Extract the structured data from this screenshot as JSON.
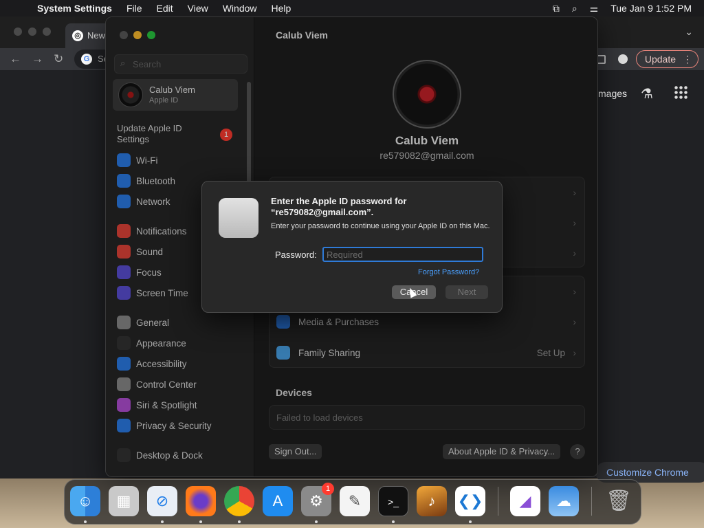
{
  "menubar": {
    "app_name": "System Settings",
    "menus": [
      "File",
      "Edit",
      "View",
      "Window",
      "Help"
    ],
    "datetime": "Tue Jan 9  1:52 PM"
  },
  "chrome": {
    "tab_title": "New",
    "omnibox_text": "Se",
    "update_label": "Update",
    "images_link": "mages",
    "customize_label": "Customize Chrome"
  },
  "settings": {
    "search_placeholder": "Search",
    "account": {
      "name": "Calub Viem",
      "sub": "Apple ID"
    },
    "update_apple_id": "Update Apple ID Settings",
    "update_badge": "1",
    "sidebar": [
      {
        "label": "Wi-Fi",
        "icon": "wifi-icon",
        "color": "#2b7de9"
      },
      {
        "label": "Bluetooth",
        "icon": "bluetooth-icon",
        "color": "#2b7de9"
      },
      {
        "label": "Network",
        "icon": "globe-icon",
        "color": "#2b7de9"
      },
      {
        "label": "Notifications",
        "icon": "bell-icon",
        "color": "#e5443a"
      },
      {
        "label": "Sound",
        "icon": "speaker-icon",
        "color": "#e5443a"
      },
      {
        "label": "Focus",
        "icon": "moon-icon",
        "color": "#5b4fd6"
      },
      {
        "label": "Screen Time",
        "icon": "hourglass-icon",
        "color": "#5b4fd6"
      },
      {
        "label": "General",
        "icon": "gear-icon",
        "color": "#8a8a8a"
      },
      {
        "label": "Appearance",
        "icon": "appearance-icon",
        "color": "#333333"
      },
      {
        "label": "Accessibility",
        "icon": "accessibility-icon",
        "color": "#2b7de9"
      },
      {
        "label": "Control Center",
        "icon": "control-center-icon",
        "color": "#8a8a8a"
      },
      {
        "label": "Siri & Spotlight",
        "icon": "siri-icon",
        "color": "#b34fd6"
      },
      {
        "label": "Privacy & Security",
        "icon": "hand-icon",
        "color": "#2b7de9"
      },
      {
        "label": "Desktop & Dock",
        "icon": "desktop-icon",
        "color": "#333333"
      }
    ],
    "main_title": "Calub Viem",
    "profile_name": "Calub Viem",
    "profile_email": "re579082@gmail.com",
    "media_purchases": "Media & Purchases",
    "family_sharing": "Family Sharing",
    "family_value": "Set Up",
    "devices_title": "Devices",
    "devices_empty": "Failed to load devices",
    "sign_out": "Sign Out...",
    "about": "About Apple ID & Privacy...",
    "help": "?"
  },
  "dialog": {
    "heading": "Enter the Apple ID password for “re579082@gmail.com”.",
    "description": "Enter your password to continue using your Apple ID on this Mac.",
    "password_label": "Password:",
    "password_placeholder": "Required",
    "forgot": "Forgot Password?",
    "cancel": "Cancel",
    "next": "Next"
  },
  "dock": {
    "apps": [
      "Finder",
      "Launchpad",
      "Safari",
      "Firefox",
      "Google Chrome",
      "App Store",
      "System Settings",
      "TextEdit",
      "Terminal",
      "GarageBand",
      "Visual Studio Code",
      "Visual Studio",
      "Weather",
      "Trash"
    ],
    "settings_badge": "1"
  }
}
